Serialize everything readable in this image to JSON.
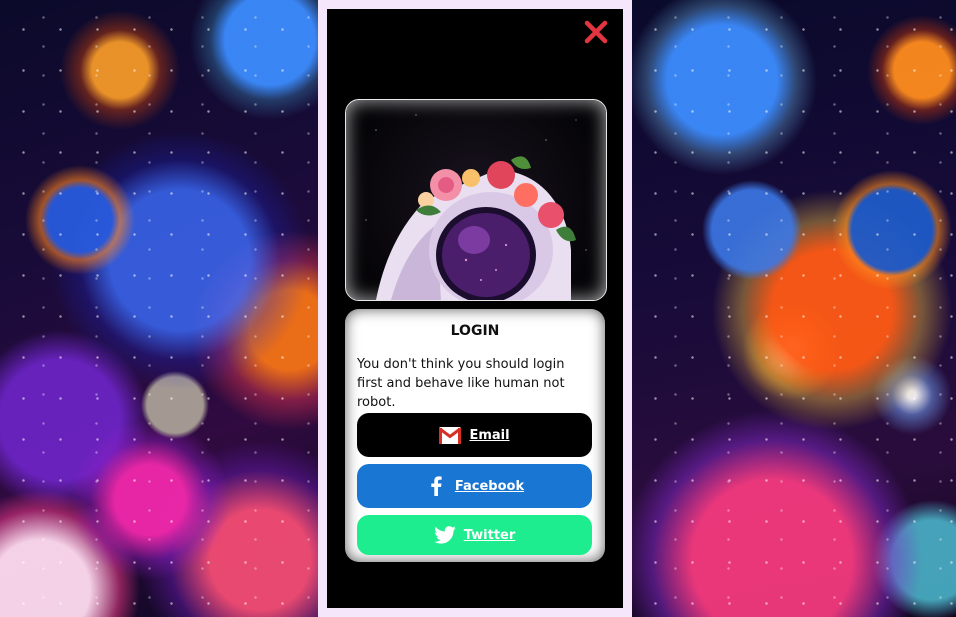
{
  "close": {
    "icon": "close-x-icon",
    "color": "#e3343f"
  },
  "hero": {
    "image": "astronaut-helmet-with-flowers"
  },
  "login": {
    "title": "LOGIN",
    "message": "You don't think you should login first and behave like human not robot."
  },
  "buttons": {
    "email": {
      "label": "Email",
      "icon": "gmail-icon",
      "color": "#000000"
    },
    "facebook": {
      "label": "Facebook",
      "icon": "facebook-icon",
      "color": "#1976d2"
    },
    "twitter": {
      "label": "Twitter",
      "icon": "twitter-icon",
      "color": "#1ded8e"
    }
  }
}
